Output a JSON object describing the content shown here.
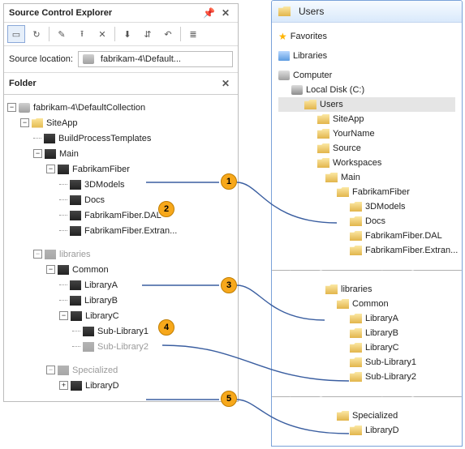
{
  "sce": {
    "title": "Source Control Explorer",
    "source_location_label": "Source location:",
    "source_location_value": "fabrikam-4\\Default...",
    "folder_header": "Folder",
    "tree": {
      "root": "fabrikam-4\\DefaultCollection",
      "siteapp": "SiteApp",
      "bpt": "BuildProcessTemplates",
      "main": "Main",
      "ff": "FabrikamFiber",
      "ff_3d": "3DModels",
      "ff_docs": "Docs",
      "ff_dal": "FabrikamFiber.DAL",
      "ff_ext": "FabrikamFiber.Extran...",
      "libraries": "libraries",
      "common": "Common",
      "liba": "LibraryA",
      "libb": "LibraryB",
      "libc": "LibraryC",
      "sub1": "Sub-Library1",
      "sub2": "Sub-Library2",
      "specialized": "Specialized",
      "libd": "LibraryD"
    }
  },
  "users": {
    "title": "Users",
    "favorites": "Favorites",
    "libraries": "Libraries",
    "computer": "Computer",
    "localdisk": "Local Disk (C:)",
    "users_folder": "Users",
    "siteapp": "SiteApp",
    "yourname": "YourName",
    "source": "Source",
    "workspaces": "Workspaces",
    "main": "Main",
    "ff": "FabrikamFiber",
    "ff_3d": "3DModels",
    "ff_docs": "Docs",
    "ff_dal": "FabrikamFiber.DAL",
    "ff_ext": "FabrikamFiber.Extran...",
    "libraries2": "libraries",
    "common": "Common",
    "liba": "LibraryA",
    "libb": "LibraryB",
    "libc": "LibraryC",
    "sub1": "Sub-Library1",
    "sub2": "Sub-Library2",
    "specialized": "Specialized",
    "libd": "LibraryD"
  },
  "callouts": {
    "c1": "1",
    "c2": "2",
    "c3": "3",
    "c4": "4",
    "c5": "5"
  }
}
